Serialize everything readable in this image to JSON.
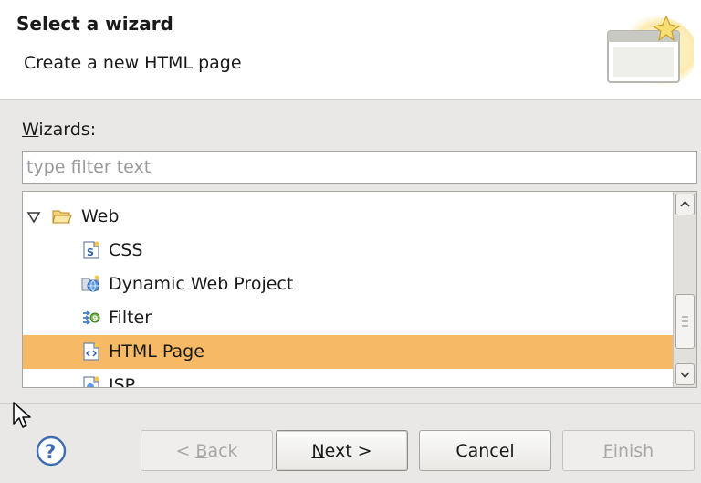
{
  "header": {
    "title": "Select a wizard",
    "description": "Create a new HTML page",
    "icon": "wizard-banner-icon"
  },
  "wizards_label": {
    "mnemonic": "W",
    "rest": "izards:"
  },
  "filter": {
    "placeholder": "type filter text",
    "value": ""
  },
  "tree": {
    "items": [
      {
        "label": "Web",
        "icon": "open-folder-icon",
        "expanded": true,
        "level": 0,
        "selected": false
      },
      {
        "label": "CSS",
        "icon": "css-file-icon",
        "level": 1,
        "selected": false
      },
      {
        "label": "Dynamic Web Project",
        "icon": "web-project-icon",
        "level": 1,
        "selected": false
      },
      {
        "label": "Filter",
        "icon": "filter-icon",
        "level": 1,
        "selected": false
      },
      {
        "label": "HTML Page",
        "icon": "html-page-icon",
        "level": 1,
        "selected": true
      },
      {
        "label": "JSP",
        "icon": "jsp-file-icon",
        "level": 1,
        "selected": false
      }
    ]
  },
  "buttons": {
    "help": {
      "icon": "help-icon"
    },
    "back": {
      "prefix": "< ",
      "mnemonic": "B",
      "rest": "ack",
      "enabled": false
    },
    "next": {
      "prefix": "",
      "mnemonic": "N",
      "rest": "ext >",
      "enabled": true,
      "default": true
    },
    "cancel": {
      "label": "Cancel",
      "enabled": true
    },
    "finish": {
      "prefix": "",
      "mnemonic": "F",
      "rest": "inish",
      "enabled": false
    }
  },
  "colors": {
    "selection": "#f6ba66",
    "header_bg": "#ffffff",
    "dialog_bg": "#e9e8e6"
  }
}
